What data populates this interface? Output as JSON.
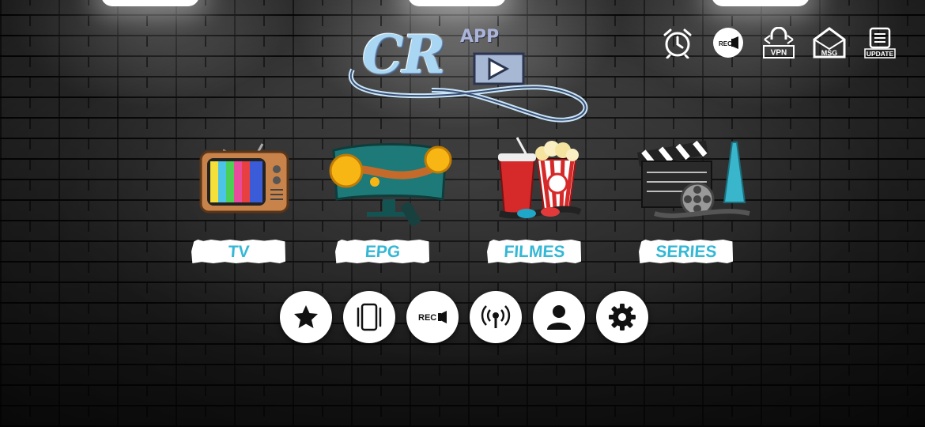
{
  "logo": {
    "main": "CR",
    "sub": "APP"
  },
  "top_bar": {
    "items": [
      {
        "name": "alarm-clock-icon"
      },
      {
        "name": "rec-icon",
        "label": "REC"
      },
      {
        "name": "vpn-icon",
        "label": "VPN"
      },
      {
        "name": "msg-icon",
        "label": "MSG"
      },
      {
        "name": "update-icon",
        "label": "UPDATE"
      }
    ]
  },
  "categories": [
    {
      "label": "TV",
      "icon": "retro-tv-icon"
    },
    {
      "label": "EPG",
      "icon": "epg-screen-icon"
    },
    {
      "label": "FILMES",
      "icon": "popcorn-cinema-icon"
    },
    {
      "label": "SERIES",
      "icon": "clapperboard-icon"
    }
  ],
  "bottom_buttons": [
    {
      "name": "favorites-star-icon"
    },
    {
      "name": "multiscreen-icon"
    },
    {
      "name": "recordings-icon",
      "label": "REC"
    },
    {
      "name": "broadcast-icon"
    },
    {
      "name": "account-icon"
    },
    {
      "name": "settings-gear-icon"
    }
  ],
  "colors": {
    "accent": "#34b8d6",
    "label_bg": "#ffffff",
    "wall": "#2a2a2a"
  }
}
